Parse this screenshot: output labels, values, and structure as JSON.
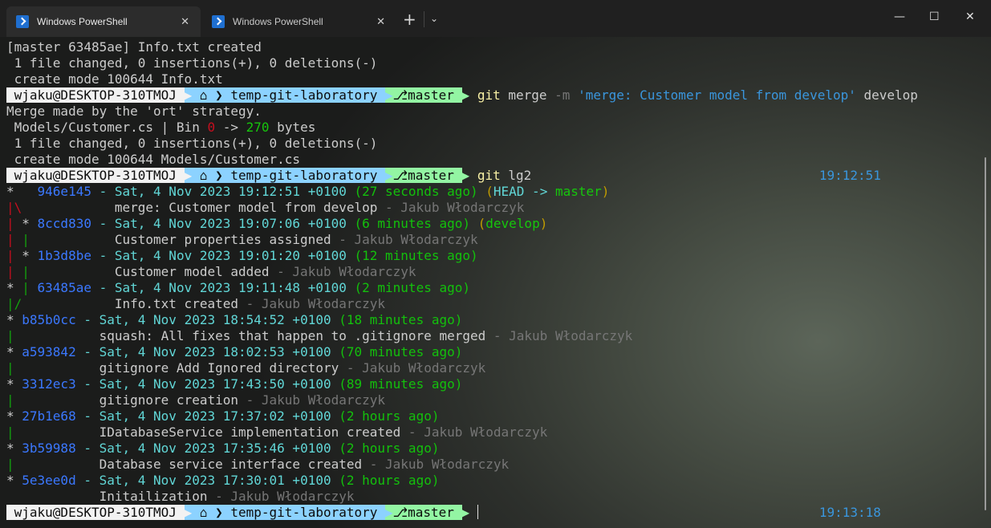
{
  "tabs": [
    {
      "label": "Windows PowerShell",
      "active": true
    },
    {
      "label": "Windows PowerShell",
      "active": false
    }
  ],
  "window_controls": {
    "new_tab": "+",
    "dropdown": "⌄",
    "minimize": "—",
    "maximize": "☐",
    "close": "✕",
    "tab_close": "✕"
  },
  "prompt": {
    "user": "wjaku@DESKTOP-310TMOJ",
    "path": "temp-git-laboratory",
    "branch": "master",
    "home_icon": "⌂",
    "branch_icon": "⎇"
  },
  "output1": [
    "[master 63485ae] Info.txt created",
    " 1 file changed, 0 insertions(+), 0 deletions(-)",
    " create mode 100644 Info.txt"
  ],
  "cmd1": {
    "git": "git",
    "sub": "merge",
    "flag": "-m",
    "msg": "'merge: Customer model from develop'",
    "arg": "develop"
  },
  "output2": {
    "l1": "Merge made by the 'ort' strategy.",
    "l2a": " Models/Customer.cs | Bin ",
    "l2b": "0",
    "l2c": " -> ",
    "l2d": "270",
    "l2e": " bytes",
    "l3": " 1 file changed, 0 insertions(+), 0 deletions(-)",
    "l4": " create mode 100644 Models/Customer.cs"
  },
  "cmd2": {
    "git": "git",
    "sub": "lg2",
    "time": "19:12:51"
  },
  "log": [
    {
      "graph": [
        [
          "*   ",
          "w"
        ]
      ],
      "hash": "946e145",
      "date": "Sat, 4 Nov 2023 19:12:51 +0100",
      "rel": "(27 seconds ago)",
      "refs": "HEAD -> master",
      "msg_graph": [
        [
          "|\\",
          "r"
        ],
        [
          "  ",
          "w"
        ]
      ],
      "msg_indent": "           ",
      "msg": "merge: Customer model from develop",
      "author": "Jakub Włodarczyk"
    },
    {
      "graph": [
        [
          "| ",
          "r"
        ],
        [
          "* ",
          "w"
        ]
      ],
      "hash": "8ccd830",
      "date": "Sat, 4 Nov 2023 19:07:06 +0100",
      "rel": "(6 minutes ago)",
      "refs": "develop",
      "msg_graph": [
        [
          "| ",
          "r"
        ],
        [
          "| ",
          "g"
        ]
      ],
      "msg_indent": "           ",
      "msg": "Customer properties assigned",
      "author": "Jakub Włodarczyk"
    },
    {
      "graph": [
        [
          "| ",
          "r"
        ],
        [
          "* ",
          "w"
        ]
      ],
      "hash": "1b3d8be",
      "date": "Sat, 4 Nov 2023 19:01:20 +0100",
      "rel": "(12 minutes ago)",
      "refs": "",
      "msg_graph": [
        [
          "| ",
          "r"
        ],
        [
          "| ",
          "g"
        ]
      ],
      "msg_indent": "           ",
      "msg": "Customer model added",
      "author": "Jakub Włodarczyk"
    },
    {
      "graph": [
        [
          "* ",
          "w"
        ],
        [
          "| ",
          "g"
        ]
      ],
      "hash": "63485ae",
      "date": "Sat, 4 Nov 2023 19:11:48 +0100",
      "rel": "(2 minutes ago)",
      "refs": "",
      "msg_graph": [
        [
          "|/",
          "g"
        ],
        [
          "  ",
          "w"
        ]
      ],
      "msg_indent": "           ",
      "msg": "Info.txt created",
      "author": "Jakub Włodarczyk"
    },
    {
      "graph": [
        [
          "* ",
          "w"
        ]
      ],
      "hash": "b85b0cc",
      "date": "Sat, 4 Nov 2023 18:54:52 +0100",
      "rel": "(18 minutes ago)",
      "refs": "",
      "msg_graph": [
        [
          "| ",
          "g"
        ]
      ],
      "msg_indent": "           ",
      "msg": "squash: All fixes that happen to .gitignore merged",
      "author": "Jakub Włodarczyk"
    },
    {
      "graph": [
        [
          "* ",
          "w"
        ]
      ],
      "hash": "a593842",
      "date": "Sat, 4 Nov 2023 18:02:53 +0100",
      "rel": "(70 minutes ago)",
      "refs": "",
      "msg_graph": [
        [
          "| ",
          "g"
        ]
      ],
      "msg_indent": "           ",
      "msg": "gitignore Add Ignored directory",
      "author": "Jakub Włodarczyk"
    },
    {
      "graph": [
        [
          "* ",
          "w"
        ]
      ],
      "hash": "3312ec3",
      "date": "Sat, 4 Nov 2023 17:43:50 +0100",
      "rel": "(89 minutes ago)",
      "refs": "",
      "msg_graph": [
        [
          "| ",
          "g"
        ]
      ],
      "msg_indent": "           ",
      "msg": "gitignore creation",
      "author": "Jakub Włodarczyk"
    },
    {
      "graph": [
        [
          "* ",
          "w"
        ]
      ],
      "hash": "27b1e68",
      "date": "Sat, 4 Nov 2023 17:37:02 +0100",
      "rel": "(2 hours ago)",
      "refs": "",
      "msg_graph": [
        [
          "| ",
          "g"
        ]
      ],
      "msg_indent": "           ",
      "msg": "IDatabaseService implementation created",
      "author": "Jakub Włodarczyk"
    },
    {
      "graph": [
        [
          "* ",
          "w"
        ]
      ],
      "hash": "3b59988",
      "date": "Sat, 4 Nov 2023 17:35:46 +0100",
      "rel": "(2 hours ago)",
      "refs": "",
      "msg_graph": [
        [
          "| ",
          "g"
        ]
      ],
      "msg_indent": "           ",
      "msg": "Database service interface created",
      "author": "Jakub Włodarczyk"
    },
    {
      "graph": [
        [
          "* ",
          "w"
        ]
      ],
      "hash": "5e3ee0d",
      "date": "Sat, 4 Nov 2023 17:30:01 +0100",
      "rel": "(2 hours ago)",
      "refs": "",
      "msg_graph": [
        [
          "  ",
          "w"
        ]
      ],
      "msg_indent": "           ",
      "msg": "Initailization",
      "author": "Jakub Włodarczyk"
    }
  ],
  "final_prompt": {
    "time": "19:13:18"
  },
  "colors": {
    "tab_bg": "#2c2c2c",
    "titlebar_bg": "#202020",
    "user_seg": "#f2f2f2",
    "path_seg": "#8cd2ff",
    "git_seg": "#93f5a3"
  }
}
